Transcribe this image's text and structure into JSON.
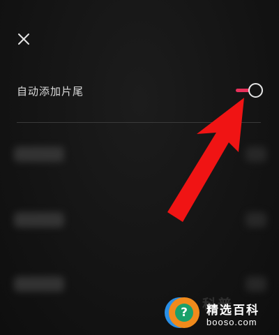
{
  "header": {
    "close_icon": "close-icon"
  },
  "setting": {
    "label": "自动添加片尾",
    "toggle_on": true,
    "accent_color": "#e8305a"
  },
  "annotation": {
    "arrow_color": "#f01414",
    "arrow_icon": "pointer-arrow"
  },
  "watermark": {
    "badge_glyph": "?",
    "title": "精选百科",
    "faint_text": "科普",
    "url": "booso.com"
  }
}
